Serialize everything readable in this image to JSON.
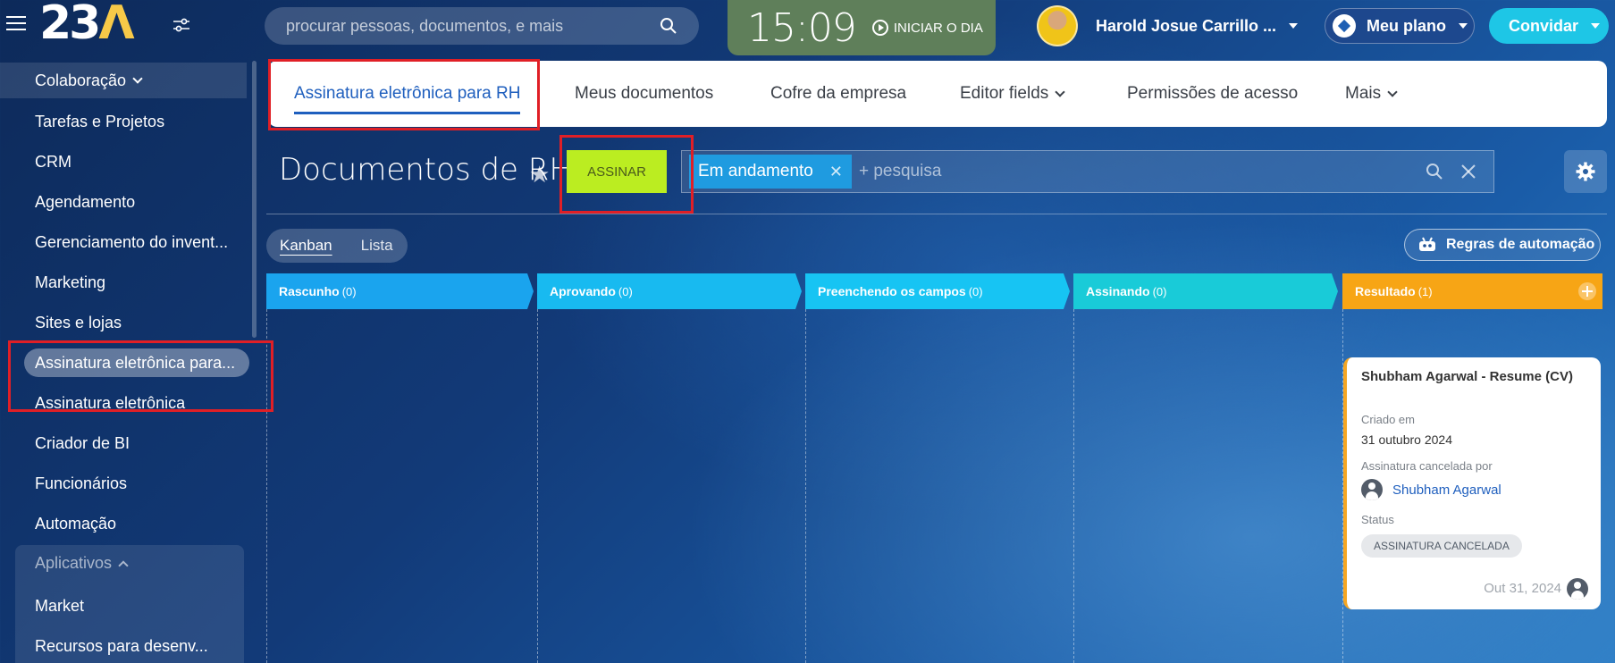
{
  "topbar": {
    "logo": "23Λ",
    "search_placeholder": "procurar pessoas, documentos, e mais",
    "clock": "15:09",
    "start_day": "INICIAR O DIA",
    "user_name": "Harold Josue Carrillo ...",
    "plan_label": "Meu plano",
    "invite_label": "Convidar"
  },
  "sidebar": {
    "items": [
      {
        "label": "Colaboração"
      },
      {
        "label": "Tarefas e Projetos"
      },
      {
        "label": "CRM"
      },
      {
        "label": "Agendamento"
      },
      {
        "label": "Gerenciamento do invent..."
      },
      {
        "label": "Marketing"
      },
      {
        "label": "Sites e lojas"
      },
      {
        "label": "Assinatura eletrônica para..."
      },
      {
        "label": "Assinatura eletrônica"
      },
      {
        "label": "Criador de BI"
      },
      {
        "label": "Funcionários"
      },
      {
        "label": "Automação"
      }
    ],
    "group_title": "Aplicativos",
    "group_items": [
      {
        "label": "Market"
      },
      {
        "label": "Recursos para desenv..."
      }
    ]
  },
  "tabs": [
    {
      "label": "Assinatura eletrônica para RH"
    },
    {
      "label": "Meus documentos"
    },
    {
      "label": "Cofre da empresa"
    },
    {
      "label": "Editor fields"
    },
    {
      "label": "Permissões de acesso"
    },
    {
      "label": "Mais"
    }
  ],
  "toolbar": {
    "page_title": "Documentos de RH",
    "sign_label": "ASSINAR",
    "filter_chip": "Em andamento",
    "filter_placeholder": "+ pesquisa",
    "view_kanban": "Kanban",
    "view_list": "Lista",
    "automation_label": "Regras de automação"
  },
  "kanban": {
    "columns": [
      {
        "title": "Rascunho",
        "count": "(0)",
        "color": "#1aa4ee"
      },
      {
        "title": "Aprovando",
        "count": "(0)",
        "color": "#18baf0"
      },
      {
        "title": "Preenchendo os campos",
        "count": "(0)",
        "color": "#17c4f3"
      },
      {
        "title": "Assinando",
        "count": "(0)",
        "color": "#19cbd8"
      },
      {
        "title": "Resultado",
        "count": "(1)",
        "color": "#f7a515"
      }
    ],
    "card": {
      "title": "Shubham Agarwal - Resume (CV)",
      "created_label": "Criado em",
      "created_value": "31 outubro 2024",
      "cancelled_label": "Assinatura cancelada por",
      "cancelled_by": "Shubham Agarwal",
      "status_label": "Status",
      "status_value": "ASSINATURA CANCELADA",
      "date": "Out 31, 2024"
    }
  },
  "colors": {
    "accent_blue": "#1f5fbe",
    "sign_button": "#bbed21",
    "highlight_box": "#e01f26"
  }
}
